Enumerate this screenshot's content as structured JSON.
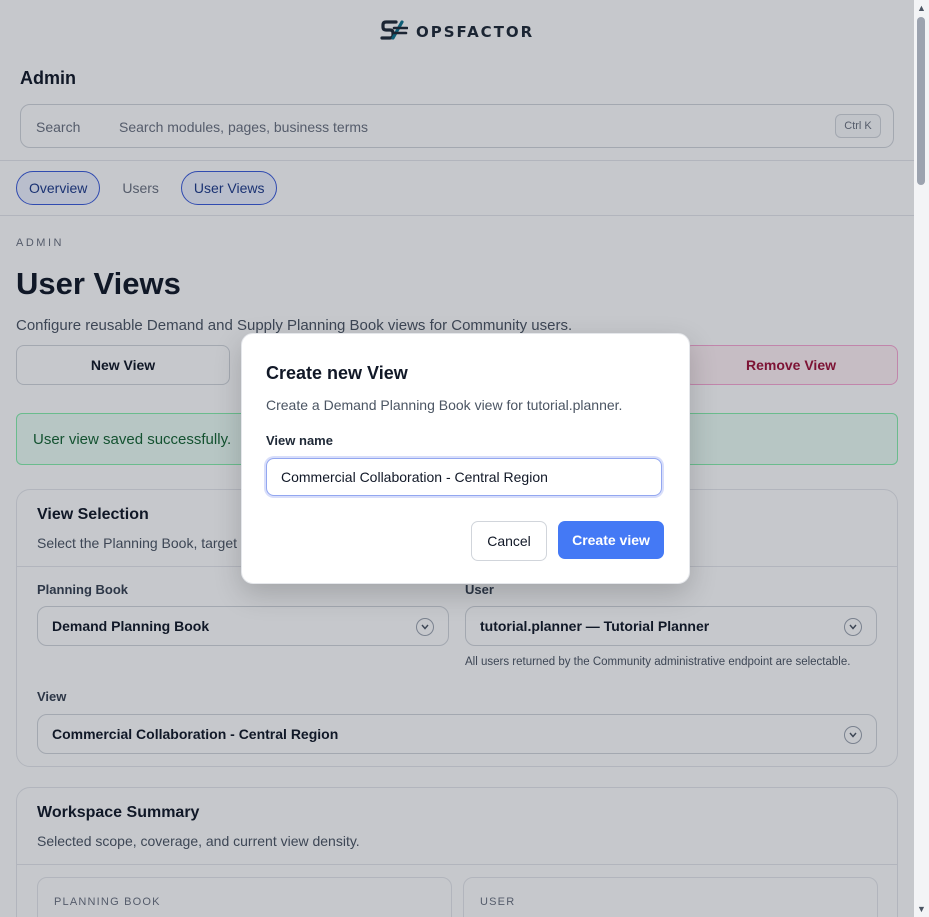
{
  "brand": {
    "name": "OPSFACTOR",
    "logo_icon": "opsfactor-logo-icon"
  },
  "header": {
    "title": "Admin",
    "search": {
      "label": "Search",
      "placeholder": "Search modules, pages, business terms",
      "shortcut": "Ctrl K"
    }
  },
  "tabs": [
    {
      "label": "Overview"
    },
    {
      "label": "Users"
    },
    {
      "label": "User Views"
    }
  ],
  "main": {
    "eyebrow": "ADMIN",
    "title": "User Views",
    "subtitle": "Configure reusable Demand and Supply Planning Book views for Community users.",
    "actions": {
      "new_view": "New View",
      "remove_view": "Remove View"
    },
    "alert": "User view saved successfully."
  },
  "view_selection": {
    "title": "View Selection",
    "subtitle": "Select the Planning Book, target u",
    "planning_book": {
      "label": "Planning Book",
      "value": "Demand Planning Book"
    },
    "user": {
      "label": "User",
      "value": "tutorial.planner — Tutorial Planner",
      "hint": "All users returned by the Community administrative endpoint are selectable."
    },
    "view": {
      "label": "View",
      "value": "Commercial Collaboration - Central Region"
    }
  },
  "workspace_summary": {
    "title": "Workspace Summary",
    "subtitle": "Selected scope, coverage, and current view density.",
    "tiles": [
      {
        "label": "PLANNING BOOK"
      },
      {
        "label": "USER"
      }
    ]
  },
  "modal": {
    "title": "Create new View",
    "description": "Create a Demand Planning Book view for tutorial.planner.",
    "field_label": "View name",
    "field_value": "Commercial Collaboration - Central Region",
    "cancel": "Cancel",
    "confirm": "Create view"
  },
  "colors": {
    "accent": "#4479f5",
    "success_text": "#166534",
    "danger_text": "#9f1239"
  }
}
